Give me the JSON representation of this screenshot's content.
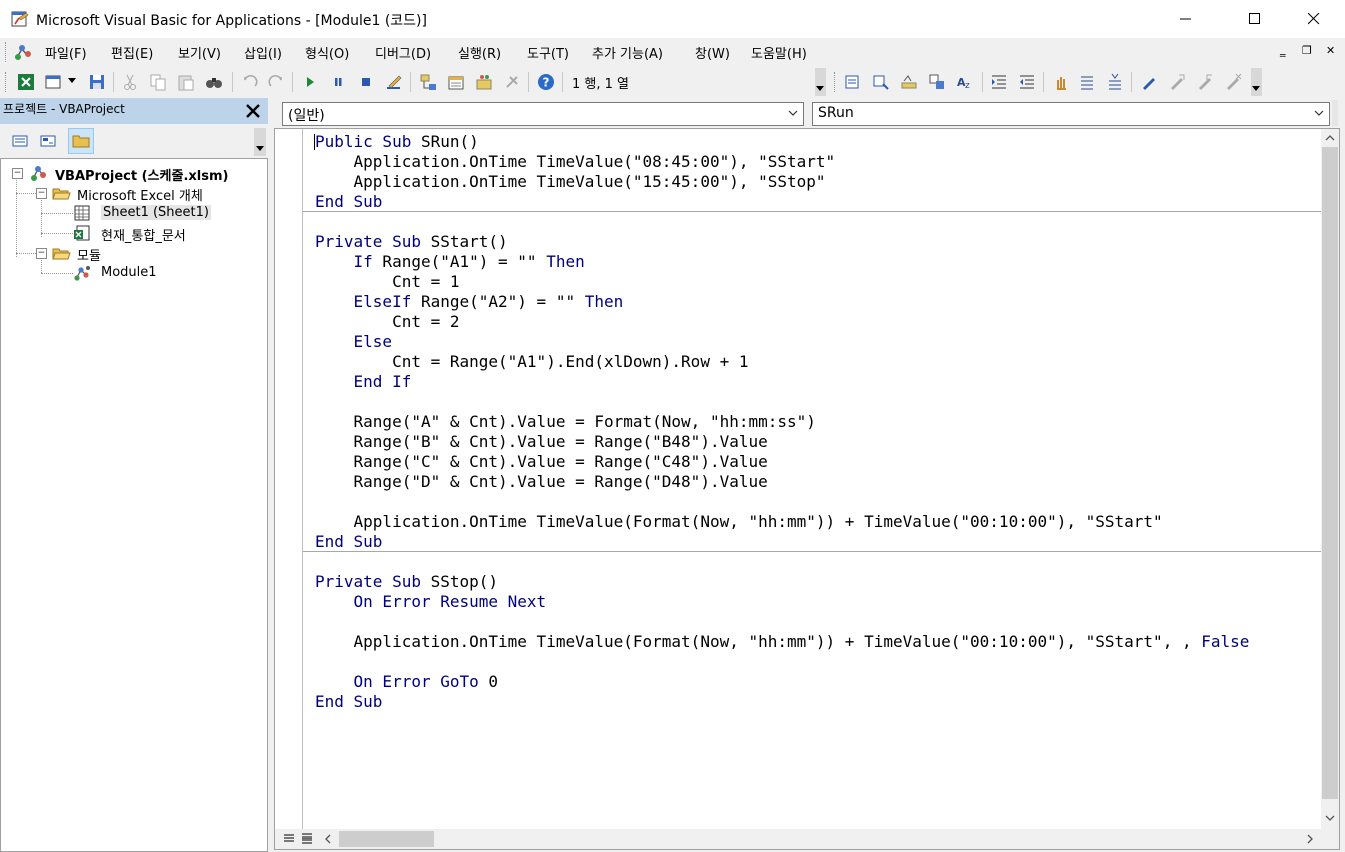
{
  "window": {
    "title": "Microsoft Visual Basic for Applications - [Module1 (코드)]",
    "minimize": "─",
    "maximize": "☐",
    "close": "✕"
  },
  "menu": {
    "items": [
      "파일(F)",
      "편집(E)",
      "보기(V)",
      "삽입(I)",
      "형식(O)",
      "디버그(D)",
      "실행(R)",
      "도구(T)",
      "추가 기능(A)",
      "창(W)",
      "도움말(H)"
    ],
    "mdi_minimize": "‗",
    "mdi_restore": "❐",
    "mdi_close": "✕"
  },
  "toolbar": {
    "position": "1 행, 1 열"
  },
  "project": {
    "title": "프로젝트 - VBAProject",
    "close": "✕",
    "tree": {
      "root": "VBAProject (스케줄.xlsm)",
      "folder_excel": "Microsoft Excel 개체",
      "sheet1": "Sheet1 (Sheet1)",
      "workbook": "현재_통합_문서",
      "folder_modules": "모듈",
      "module1": "Module1"
    }
  },
  "code": {
    "object_combo": "(일반)",
    "proc_combo": "SRun",
    "lines": [
      [
        {
          "k": 1,
          "t": "Public Sub"
        },
        {
          "t": " SRun()"
        }
      ],
      [
        {
          "t": "    Application.OnTime TimeValue(\"08:45:00\"), \"SStart\""
        }
      ],
      [
        {
          "t": "    Application.OnTime TimeValue(\"15:45:00\"), \"SStop\""
        }
      ],
      [
        {
          "k": 1,
          "t": "End Sub"
        }
      ],
      [],
      [
        {
          "k": 1,
          "t": "Private Sub"
        },
        {
          "t": " SStart()"
        }
      ],
      [
        {
          "t": "    "
        },
        {
          "k": 1,
          "t": "If"
        },
        {
          "t": " Range(\"A1\") = \"\" "
        },
        {
          "k": 1,
          "t": "Then"
        }
      ],
      [
        {
          "t": "        Cnt = 1"
        }
      ],
      [
        {
          "t": "    "
        },
        {
          "k": 1,
          "t": "ElseIf"
        },
        {
          "t": " Range(\"A2\") = \"\" "
        },
        {
          "k": 1,
          "t": "Then"
        }
      ],
      [
        {
          "t": "        Cnt = 2"
        }
      ],
      [
        {
          "t": "    "
        },
        {
          "k": 1,
          "t": "Else"
        }
      ],
      [
        {
          "t": "        Cnt = Range(\"A1\").End(xlDown).Row + 1"
        }
      ],
      [
        {
          "t": "    "
        },
        {
          "k": 1,
          "t": "End If"
        }
      ],
      [],
      [
        {
          "t": "    Range(\"A\" & Cnt).Value = Format(Now, \"hh:mm:ss\")"
        }
      ],
      [
        {
          "t": "    Range(\"B\" & Cnt).Value = Range(\"B48\").Value"
        }
      ],
      [
        {
          "t": "    Range(\"C\" & Cnt).Value = Range(\"C48\").Value"
        }
      ],
      [
        {
          "t": "    Range(\"D\" & Cnt).Value = Range(\"D48\").Value"
        }
      ],
      [],
      [
        {
          "t": "    Application.OnTime TimeValue(Format(Now, \"hh:mm\")) + TimeValue(\"00:10:00\"), \"SStart\""
        }
      ],
      [
        {
          "k": 1,
          "t": "End Sub"
        }
      ],
      [],
      [
        {
          "k": 1,
          "t": "Private Sub"
        },
        {
          "t": " SStop()"
        }
      ],
      [
        {
          "t": "    "
        },
        {
          "k": 1,
          "t": "On Error Resume Next"
        }
      ],
      [],
      [
        {
          "t": "    Application.OnTime TimeValue(Format(Now, \"hh:mm\")) + TimeValue(\"00:10:00\"), \"SStart\", , "
        },
        {
          "k": 1,
          "t": "False"
        }
      ],
      [],
      [
        {
          "t": "    "
        },
        {
          "k": 1,
          "t": "On Error GoTo"
        },
        {
          "t": " 0"
        }
      ],
      [
        {
          "k": 1,
          "t": "End Sub"
        }
      ]
    ]
  },
  "colors": {
    "keyword": "#00007f",
    "title_bar": "#ffffff",
    "project_header": "#bcd3ea"
  }
}
